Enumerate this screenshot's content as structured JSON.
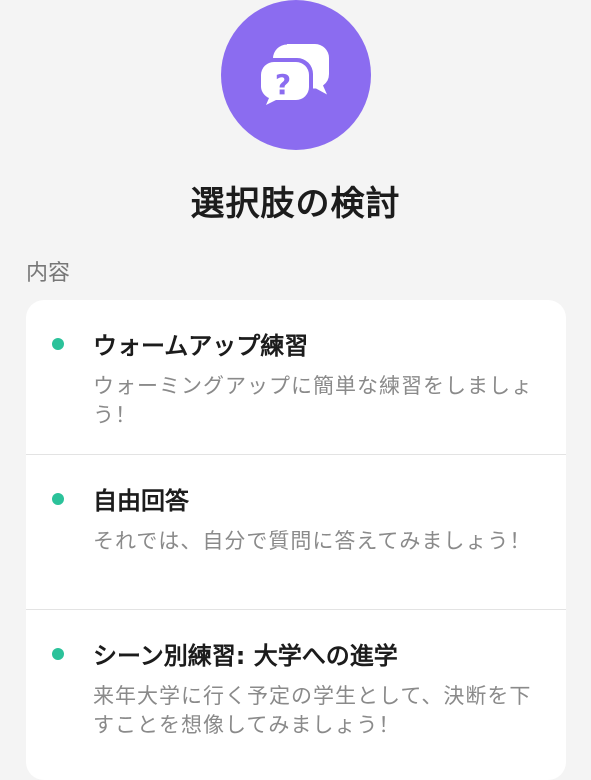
{
  "header": {
    "icon": "question-chat-bubbles-icon",
    "title": "選択肢の検討"
  },
  "section": {
    "label": "内容"
  },
  "items": [
    {
      "title": "ウォームアップ練習",
      "description": "ウォーミングアップに簡単な練習をしましょう！"
    },
    {
      "title": "自由回答",
      "description": "それでは、自分で質問に答えてみましょう！"
    },
    {
      "title": "シーン別練習: 大学への進学",
      "description": "来年大学に行く予定の学生として、決断を下すことを想像してみましょう！"
    }
  ],
  "colors": {
    "accent": "#8b6cf0",
    "bullet": "#2bc29a",
    "background": "#f4f4f4"
  }
}
